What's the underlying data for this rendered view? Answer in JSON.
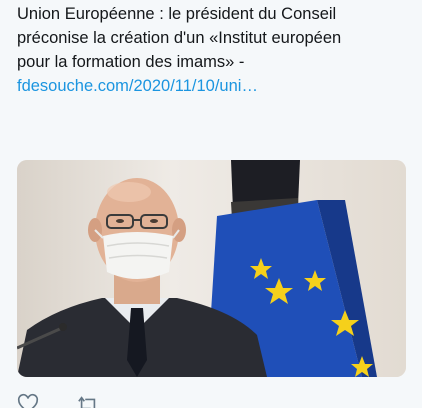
{
  "tweet": {
    "text_line1": "Union Européenne : le président du Conseil",
    "text_line2": "préconise la création d'un «Institut européen",
    "text_line3": "pour la formation des imams» -",
    "link_text": "fdesouche.com/2020/11/10/uni…"
  },
  "media": {
    "image_description_icon": "photo-of-man-with-mask-and-eu-flag"
  },
  "actions": {
    "icons": [
      "heart-icon",
      "retweet-icon"
    ]
  },
  "colors": {
    "link": "#1b95e0",
    "text": "#14171a",
    "background": "#f5f8fa",
    "eu_blue": "#1f4fb8",
    "eu_star": "#f5d01b"
  }
}
